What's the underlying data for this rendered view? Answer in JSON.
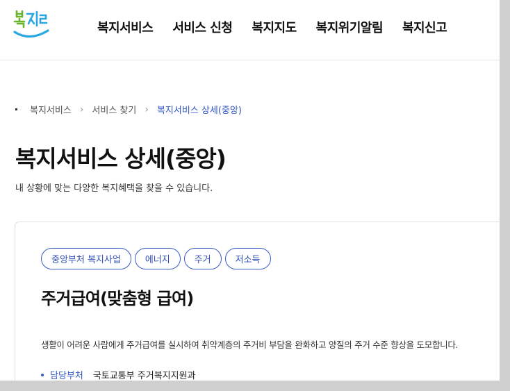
{
  "header": {
    "logo_text": "복지로",
    "nav": [
      {
        "label": "복지서비스"
      },
      {
        "label": "서비스 신청"
      },
      {
        "label": "복지지도"
      },
      {
        "label": "복지위기알림"
      },
      {
        "label": "복지신고"
      }
    ]
  },
  "breadcrumb": {
    "items": [
      "복지서비스",
      "서비스 찾기"
    ],
    "current": "복지서비스 상세(중앙)"
  },
  "page": {
    "title": "복지서비스 상세(중앙)",
    "description": "내 상황에 맞는 다양한 복지혜택을 찾을 수 있습니다."
  },
  "service": {
    "tags": [
      "중앙부처 복지사업",
      "에너지",
      "주거",
      "저소득"
    ],
    "title": "주거급여(맞춤형 급여)",
    "description": "생활이 어려운 사람에게 주거급여를 실시하여 취약계층의 주거비 부담을 완화하고 양질의 주거 수준 향상을 도모합니다.",
    "department_label": "담당부처",
    "department_value": "국토교통부 주거복지지원과"
  },
  "colors": {
    "accent": "#2f57c6",
    "logo_blue": "#2aa7e0",
    "logo_green": "#69b42e"
  }
}
